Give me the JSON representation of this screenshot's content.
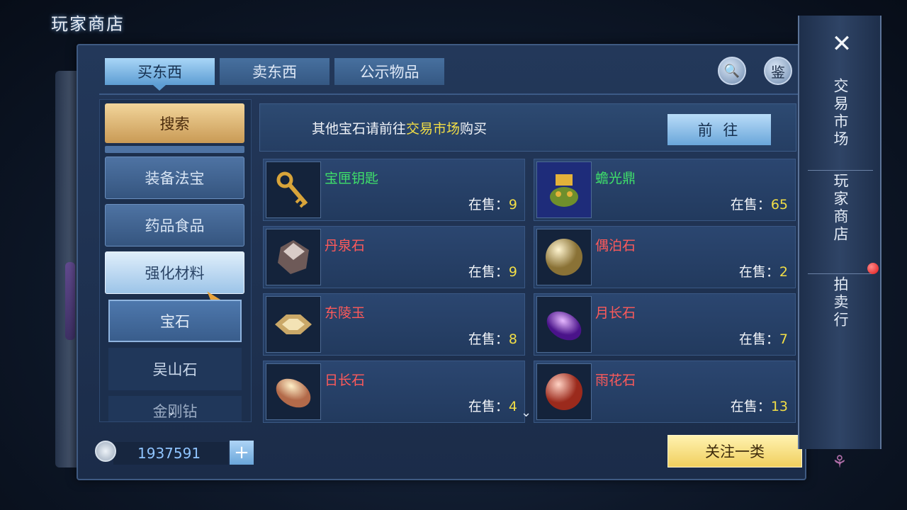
{
  "page_title": "玩家商店",
  "tabs": [
    {
      "label": "买东西",
      "active": true
    },
    {
      "label": "卖东西",
      "active": false
    },
    {
      "label": "公示物品",
      "active": false
    }
  ],
  "top_buttons": {
    "search_glyph": "🔍",
    "appraise_label": "鉴"
  },
  "categories": {
    "search_label": "搜索",
    "items": [
      "装备法宝",
      "药品食品",
      "强化材料"
    ],
    "selected": "强化材料",
    "subitems": [
      "宝石",
      "吴山石",
      "金刚钻"
    ],
    "selected_sub": "宝石"
  },
  "banner": {
    "text_before": "其他宝石请前往",
    "highlight": "交易市场",
    "text_after": "购买",
    "go_label": "前 往"
  },
  "items": [
    {
      "name": "宝匣钥匙",
      "stock_label": "在售：",
      "stock": "9",
      "color": "green",
      "icon": "key-icon"
    },
    {
      "name": "蟾光鼎",
      "stock_label": "在售：",
      "stock": "65",
      "color": "green",
      "icon": "toad-cauldron-icon"
    },
    {
      "name": "丹泉石",
      "stock_label": "在售：",
      "stock": "9",
      "color": "red",
      "icon": "dark-gem-icon"
    },
    {
      "name": "偶泊石",
      "stock_label": "在售：",
      "stock": "2",
      "color": "red",
      "icon": "gold-sphere-icon"
    },
    {
      "name": "东陵玉",
      "stock_label": "在售：",
      "stock": "8",
      "color": "red",
      "icon": "gold-gem-icon"
    },
    {
      "name": "月长石",
      "stock_label": "在售：",
      "stock": "7",
      "color": "red",
      "icon": "purple-gem-icon"
    },
    {
      "name": "日长石",
      "stock_label": "在售：",
      "stock": "4",
      "color": "red",
      "icon": "sun-gem-icon"
    },
    {
      "name": "雨花石",
      "stock_label": "在售：",
      "stock": "13",
      "color": "red",
      "icon": "red-sphere-icon"
    }
  ],
  "currency": {
    "amount": "1937591",
    "plus_label": "+"
  },
  "follow_label": "关注一类",
  "side_nav": {
    "close_glyph": "✕",
    "items": [
      "交易市场",
      "玩家商店",
      "拍卖行"
    ]
  }
}
